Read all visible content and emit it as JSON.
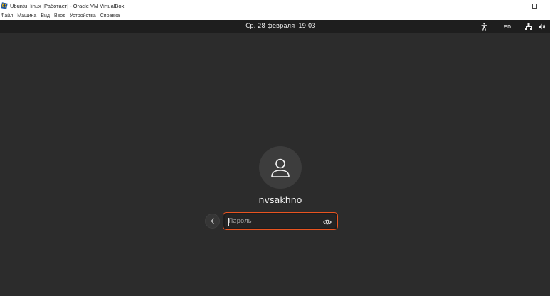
{
  "host_window": {
    "title": "Ubuntu_linux [Работает] - Oracle VM VirtualBox",
    "logo": "virtualbox-logo",
    "minimize_icon": "minimize-icon",
    "maximize_icon": "maximize-icon"
  },
  "host_menu": {
    "items": [
      "Файл",
      "Машина",
      "Вид",
      "Ввод",
      "Устройства",
      "Справка"
    ]
  },
  "topbar": {
    "date": "Ср, 28 февраля",
    "time": "19:03",
    "language": "en",
    "icons": [
      "accessibility-icon",
      "network-icon",
      "volume-icon"
    ]
  },
  "login": {
    "username": "nvsakhno",
    "avatar_icon": "user-icon",
    "back_icon": "chevron-left-icon",
    "password": {
      "value": "",
      "placeholder": "Пароль",
      "reveal_icon": "eye-icon"
    },
    "accent_color": "#e95420"
  }
}
